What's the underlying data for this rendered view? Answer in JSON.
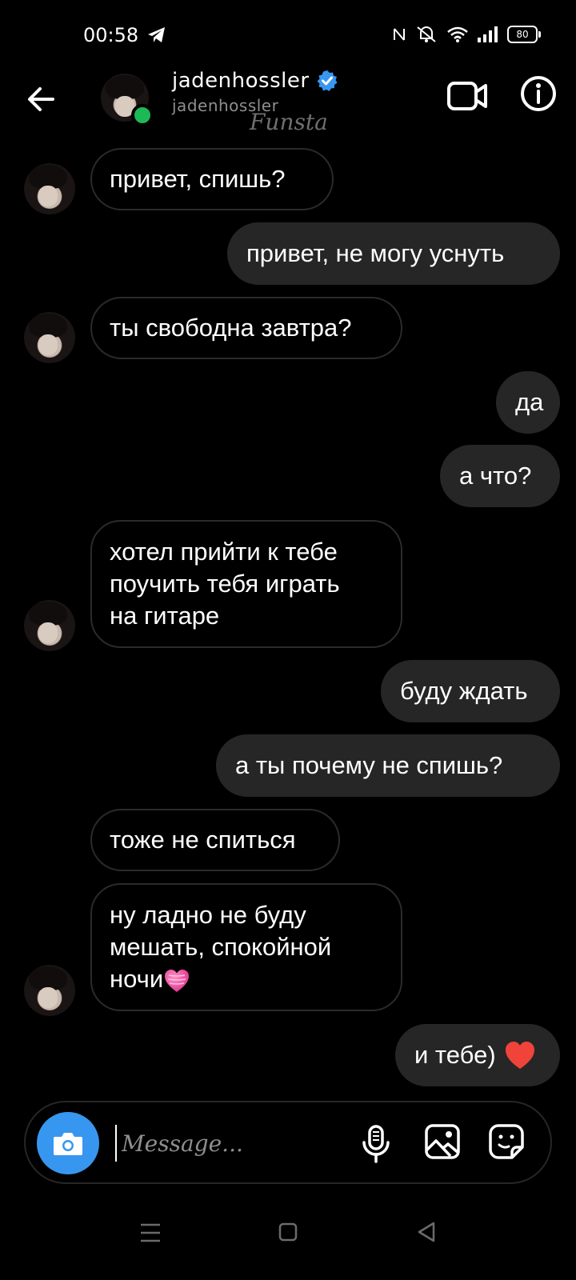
{
  "status_bar": {
    "time": "00:58",
    "battery": "80",
    "icons": [
      "telegram-icon",
      "nfc-icon",
      "mute-icon",
      "wifi-icon",
      "signal-icon",
      "battery-icon"
    ]
  },
  "header": {
    "name": "jadenhossler",
    "username": "jadenhossler",
    "watermark": "Funsta",
    "verified": true,
    "online": true
  },
  "messages": [
    {
      "side": "received",
      "text": "привет, спишь?"
    },
    {
      "side": "sent",
      "text": "привет, не могу уснуть"
    },
    {
      "side": "received",
      "text": "ты свободна завтра?"
    },
    {
      "side": "sent",
      "text": "да"
    },
    {
      "side": "sent",
      "text": "а что?"
    },
    {
      "side": "received",
      "text": "хотел прийти к тебе\nпоучить тебя играть\nна гитаре"
    },
    {
      "side": "sent",
      "text": "буду ждать"
    },
    {
      "side": "sent",
      "text": "а ты почему не спишь?"
    },
    {
      "side": "received",
      "text": "тоже не спиться"
    },
    {
      "side": "received",
      "text": "ну ладно не буду\nмешать, спокойной\nночи",
      "emoji": "pink-heart"
    },
    {
      "side": "sent",
      "text": "и тебе)",
      "emoji": "red-heart"
    }
  ],
  "composer": {
    "placeholder": "Message..."
  },
  "colors": {
    "background": "#000000",
    "sent_bubble": "#262626",
    "received_border": "#2b2b2b",
    "camera_button": "#3797f0",
    "online_dot": "#1db954",
    "verified": "#3797f0"
  }
}
